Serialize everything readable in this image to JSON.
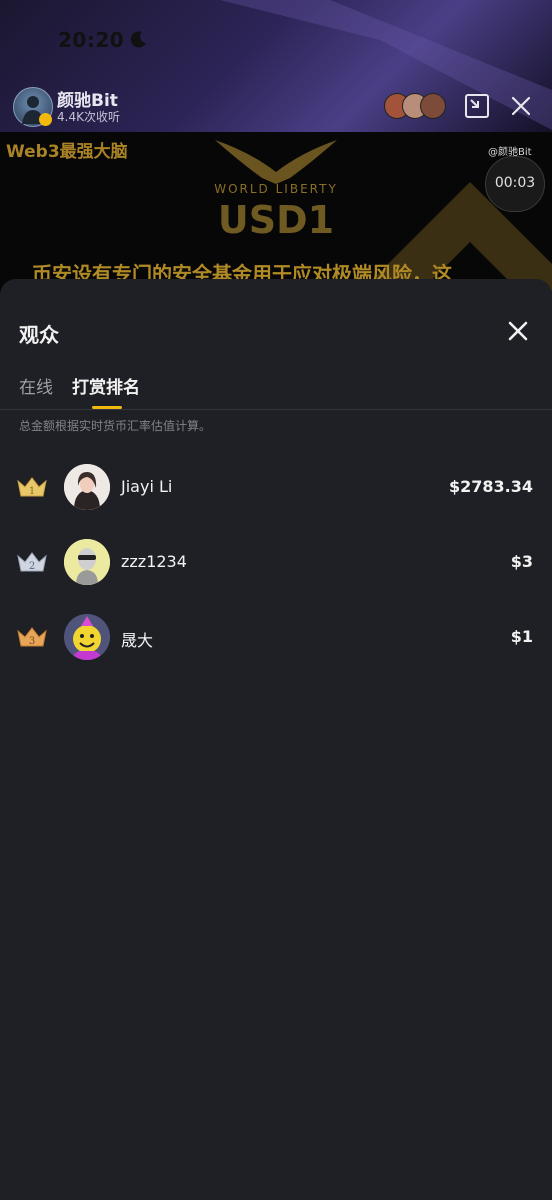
{
  "status_bar": {
    "time": "20:20"
  },
  "live_header": {
    "host_name": "颜驰Bit",
    "listeners": "4.4K次收听"
  },
  "video": {
    "brand": "Web3最强大脑",
    "logo_caption": "WORLD LIBERTY",
    "logo_title": "USD1",
    "subtitle": "币安设有专门的安全基金用于应对极端风险，这",
    "watermark": "@颜驰Bit",
    "timer": "00:03"
  },
  "sheet": {
    "title": "观众",
    "tabs": [
      {
        "label": "在线",
        "active": false
      },
      {
        "label": "打赏排名",
        "active": true
      }
    ],
    "note": "总金额根据实时货币汇率估值计算。",
    "ranking": [
      {
        "rank": "1",
        "name": "Jiayi Li",
        "amount": "$2783.34",
        "crown_color": "#e9c86a"
      },
      {
        "rank": "2",
        "name": "zzz1234",
        "amount": "$3",
        "crown_color": "#cfd6e2"
      },
      {
        "rank": "3",
        "name": "晟大",
        "amount": "$1",
        "crown_color": "#e7a55a"
      }
    ]
  },
  "colors": {
    "accent": "#f0b90b",
    "sheet_bg": "#1f2026"
  }
}
